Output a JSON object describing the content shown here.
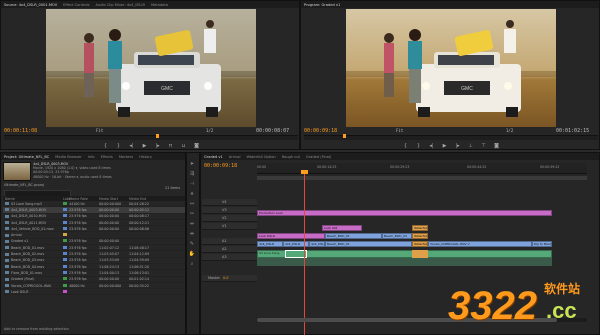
{
  "source_monitor": {
    "tabs": [
      "Source: 4x4_DSLR_0001.MOV",
      "Effect Controls",
      "Audio Clip Mixer: 4x4_DSLR",
      "Metadata"
    ],
    "timecode_in": "00:00:11:08",
    "fit": "Fit",
    "timecode_out": "00:00:08:07",
    "page": "1/2"
  },
  "program_monitor": {
    "tabs": [
      "Program: Graded v1"
    ],
    "timecode_in": "00:00:09:18",
    "fit": "Fit",
    "timecode_out": "00:01:02:15",
    "page": "1/2"
  },
  "project_panel": {
    "tabs": [
      "Project: Ultimate_NFL_BC",
      "Media Browser",
      "Info",
      "Effects",
      "Markers",
      "History"
    ],
    "clip_name": "4x4_DSLR_0003.MOV",
    "info_lines": [
      "Movie, 1920 x 1080 (1.0) ▾, video used 8 times",
      "00:00:05:13, 23.976p",
      "48000 Hz · 16-bit · Stereo ▾, audio used 8 times"
    ],
    "folder": "Ultimate_NFL_BC.prproj",
    "item_count": "21 Items",
    "columns": [
      "Name",
      "Label",
      "Frame Rate",
      "Media Start",
      "Media End"
    ],
    "rows": [
      {
        "name": "03 Love Song.mp3",
        "fps": "44100 Hz",
        "start": "00:00:00:000",
        "end": "00:04:26:22",
        "color": "#3f9a4c"
      },
      {
        "name": "4x4_DSLR_0003.MOV",
        "fps": "23.976 fps",
        "start": "00:00:00:00",
        "end": "00:00:05:12",
        "color": "#5a86c9"
      },
      {
        "name": "4x4_DSLR_0010.MOV",
        "fps": "23.976 fps",
        "start": "00:00:00:00",
        "end": "00:00:08:17",
        "color": "#5a86c9"
      },
      {
        "name": "4x4_DSLR_0011.MOV",
        "fps": "23.976 fps",
        "start": "00:00:00:00",
        "end": "00:00:12:21",
        "color": "#5a86c9"
      },
      {
        "name": "4x4_Vehicle_BOD_01.mov",
        "fps": "23.976 fps",
        "start": "00:00:00:00",
        "end": "00:00:08:06",
        "color": "#5a86c9"
      },
      {
        "name": "Arrival",
        "fps": "",
        "start": "",
        "end": "",
        "color": "#d4a63f"
      },
      {
        "name": "Graded v1",
        "fps": "23.976 fps",
        "start": "00:00:00:00",
        "end": "",
        "color": "#3f9a4c"
      },
      {
        "name": "Beach_BOD_01.mov",
        "fps": "23.976 fps",
        "start": "11:02:07:12",
        "end": "11:08:48:17",
        "color": "#5a86c9"
      },
      {
        "name": "Beach_BOD_02.mov",
        "fps": "23.976 fps",
        "start": "11:03:05:07",
        "end": "11:04:12:09",
        "color": "#5a86c9"
      },
      {
        "name": "Beach_BOD_03.mov",
        "fps": "23.976 fps",
        "start": "11:03:53:09",
        "end": "11:04:59:09",
        "color": "#5a86c9"
      },
      {
        "name": "Beach_BOD_04.mov",
        "fps": "23.976 fps",
        "start": "11:08:24:13",
        "end": "11:06:51:20",
        "color": "#5a86c9"
      },
      {
        "name": "Flora_BOD_01.mov",
        "fps": "23.976 fps",
        "start": "11:04:00:13",
        "end": "11:06:13:01",
        "color": "#5a86c9"
      },
      {
        "name": "Graded (Final)",
        "fps": "23.976 fps",
        "start": "00:00:00:00",
        "end": "00:01:02:14",
        "color": "#3f9a4c"
      },
      {
        "name": "Vocals_COPRIGGOL.WAV",
        "fps": "48000 Hz",
        "start": "00:00:00:000",
        "end": "00:00:35:22",
        "color": "#3f9a4c"
      },
      {
        "name": "Look DSLR",
        "fps": "",
        "start": "",
        "end": "",
        "color": "#c84fc8"
      }
    ],
    "status": "Add or remove from existing selection"
  },
  "timeline": {
    "tabs": [
      "Graded v1",
      "Arrival",
      "Waterfall Option",
      "Rough cut",
      "Graded (Final)"
    ],
    "timecode": "00:00:09:18",
    "ruler_marks": [
      "00:00",
      "00:00:14:23",
      "00:00:29:23",
      "00:00:44:22",
      "00:00:59:22"
    ],
    "video_tracks": [
      "V4",
      "V3",
      "V2",
      "V1"
    ],
    "audio_tracks": [
      "A1",
      "A2",
      "A3"
    ],
    "master": "Master",
    "master_value": "0.0",
    "clips": {
      "production_look": "Production Look",
      "look_001": "Look 001",
      "look_dslr": "Look DSLR",
      "beach_bod_01": "Beach_BOD_01",
      "beach_bod_04": "Beach_BOD_04",
      "waterfall": "Waterfall",
      "v1_a": "4x4_DSLR",
      "v1_b": "4x4_DSLR",
      "v1_c": "4x4_DSLR",
      "v1_vocals": "Vocals_COPRIGGOL.WAV V",
      "v1_end": "Dip to Black",
      "a1_song": "03 Love Song"
    }
  },
  "watermark": {
    "number": "3322",
    "tld": ".cc",
    "cjk": "软件站"
  }
}
